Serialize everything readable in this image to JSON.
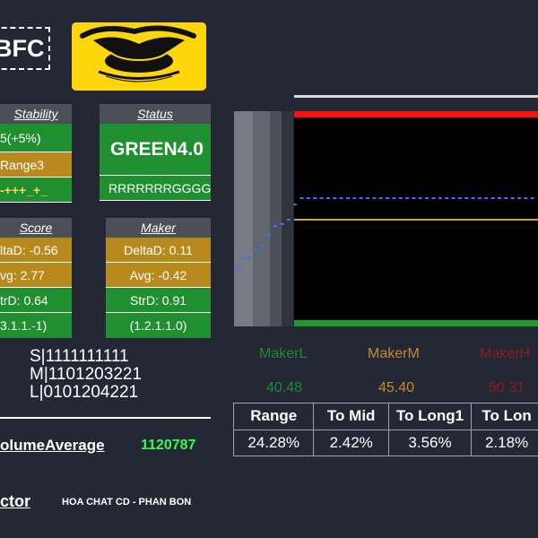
{
  "header": {
    "ticker_suffix": "BFC"
  },
  "stability": {
    "title": "Stability",
    "row1": "5(+5%)",
    "row2": "Range3",
    "row3": "-+++_+_"
  },
  "status": {
    "title": "Status",
    "value": "GREEN4.0",
    "pattern": "RRRRRRRGGGG"
  },
  "score": {
    "title": "Score",
    "row1": "ltaD: -0.56",
    "row2": "vg: 2.77",
    "row3": "trD: 0.64",
    "row4": "3.1.1.-1)"
  },
  "maker": {
    "title": "Maker",
    "row1": "DeltaD: 0.11",
    "row2": "Avg: -0.42",
    "row3": "StrD: 0.91",
    "row4": "(1.2.1.1.0)"
  },
  "sml": {
    "s": "S|1111111111",
    "m": "M|1101203221",
    "l": "L|0101204221"
  },
  "volume": {
    "label": "olumeAverage",
    "value": "1120787"
  },
  "sector": {
    "label": "ctor",
    "value": "HOA CHAT CD - PHAN BON"
  },
  "maker_levels": {
    "l_label": "MakerL",
    "m_label": "MakerM",
    "h_label": "MakerH",
    "l_value": "40.48",
    "m_value": "45.40",
    "h_value": "50.31"
  },
  "metrics": {
    "headers": [
      "Range",
      "To Mid",
      "To Long1",
      "To Lon"
    ],
    "values": [
      "24.28%",
      "2.42%",
      "3.56%",
      "2.18%"
    ]
  },
  "colors": {
    "green": "#1f8f2f",
    "gold": "#b8891d",
    "red": "#ff1010",
    "maker_l": "#1d8b2f",
    "maker_m": "#c28b2a",
    "maker_h": "#8f1b1b"
  },
  "chart_data": {
    "type": "line",
    "ylim": [
      0,
      100
    ],
    "lines": [
      {
        "color": "#ff1010",
        "value": 100
      },
      {
        "color": "#cfa43a",
        "value": 50
      },
      {
        "color": "#1a9b2c",
        "value": 0
      }
    ],
    "series": [
      {
        "values": [
          28,
          32,
          32,
          36,
          38,
          43,
          47,
          48,
          50,
          57,
          60,
          60,
          60,
          60,
          60,
          60,
          60,
          60,
          60,
          60,
          60,
          60,
          60,
          60,
          60,
          60,
          60,
          60,
          60,
          60,
          60,
          60,
          60,
          60,
          60,
          60,
          60,
          60,
          60,
          60,
          60,
          60,
          60,
          60,
          60,
          60
        ]
      }
    ]
  }
}
